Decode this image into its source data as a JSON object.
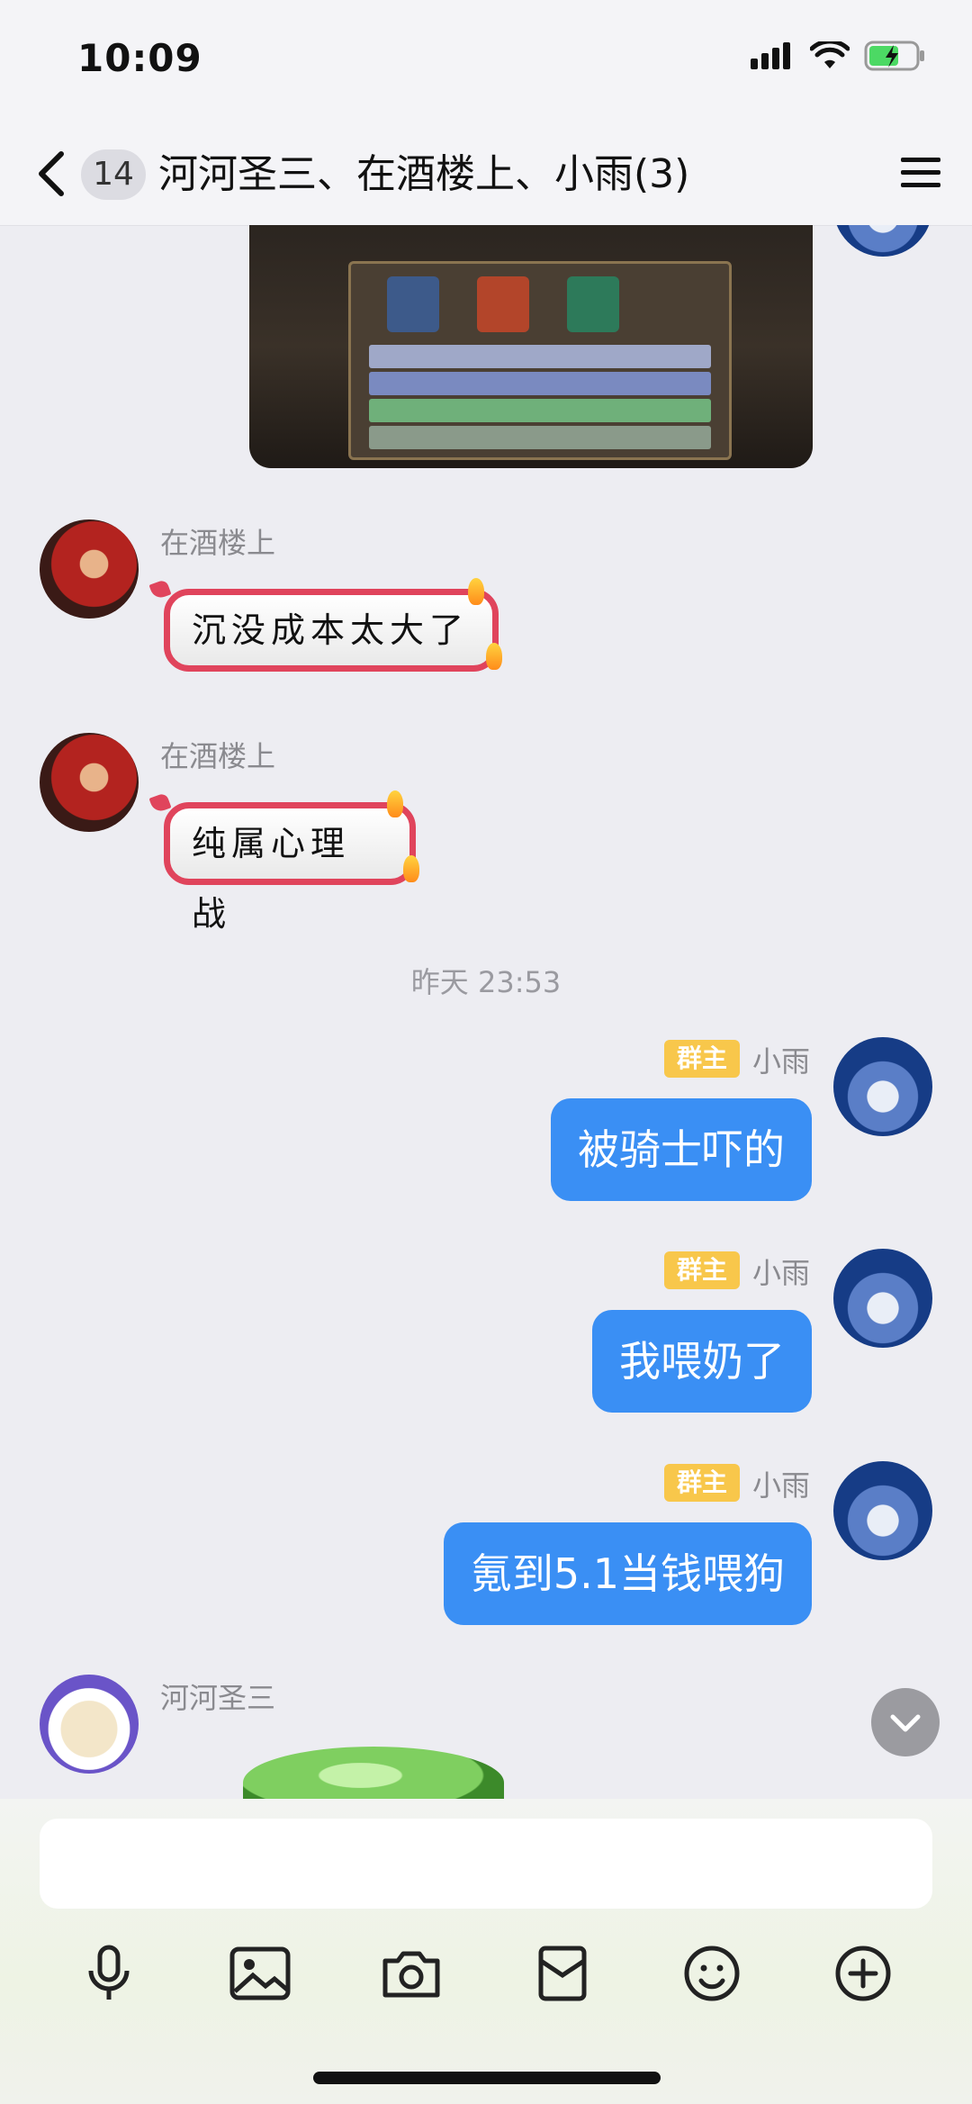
{
  "status_bar": {
    "time": "10:09"
  },
  "header": {
    "unread_count": "14",
    "title": "河河圣三、在酒楼上、小雨(3)"
  },
  "messages": [
    {
      "type": "image",
      "side": "right",
      "sender": "小雨"
    },
    {
      "type": "sticker",
      "side": "left",
      "sender": "在酒楼上",
      "text": "沉没成本太大了"
    },
    {
      "type": "sticker",
      "side": "left",
      "sender": "在酒楼上",
      "text": "纯属心理战"
    },
    {
      "type": "time",
      "text": "昨天 23:53"
    },
    {
      "type": "text",
      "side": "right",
      "sender": "小雨",
      "role": "群主",
      "text": "被骑士吓的"
    },
    {
      "type": "text",
      "side": "right",
      "sender": "小雨",
      "role": "群主",
      "text": "我喂奶了"
    },
    {
      "type": "text",
      "side": "right",
      "sender": "小雨",
      "role": "群主",
      "text": "氪到5.1当钱喂狗"
    },
    {
      "type": "sticker-partial",
      "side": "left",
      "sender": "河河圣三"
    }
  ],
  "input": {
    "placeholder": ""
  },
  "toolbar": {
    "items": [
      "microphone-icon",
      "image-icon",
      "camera-icon",
      "red-packet-icon",
      "emoji-icon",
      "plus-icon"
    ]
  },
  "colors": {
    "accent": "#3a8ff4",
    "owner_tag": "#f8c74b",
    "sticker_border": "#e0445c"
  }
}
